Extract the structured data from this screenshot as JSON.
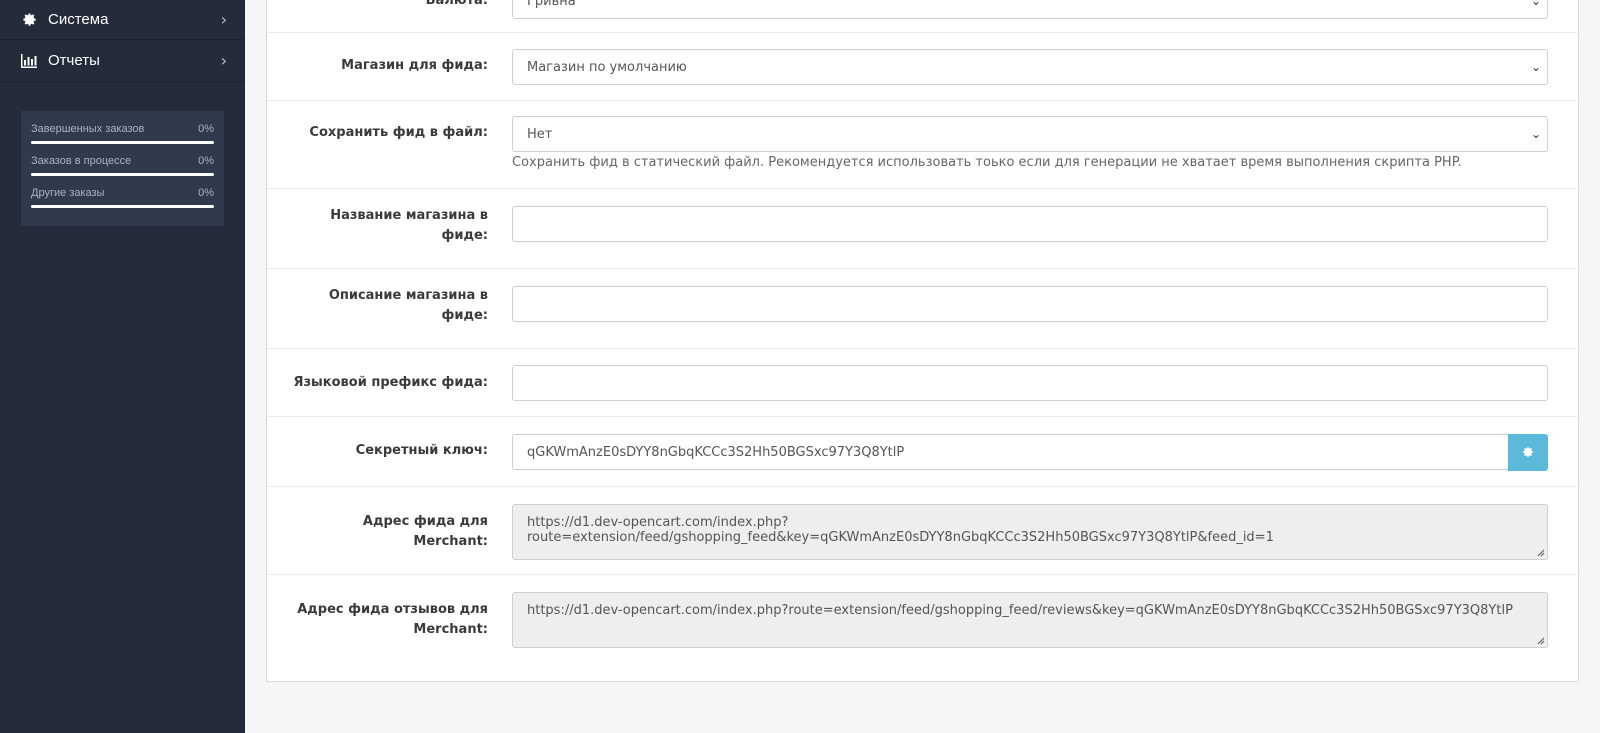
{
  "sidebar": {
    "items": [
      {
        "label": "Система",
        "icon": "gear-icon"
      },
      {
        "label": "Отчеты",
        "icon": "bar-chart-icon"
      }
    ],
    "stats": [
      {
        "label": "Завершенных заказов",
        "value": "0%",
        "fraction": 1.0
      },
      {
        "label": "Заказов в процессе",
        "value": "0%",
        "fraction": 1.0
      },
      {
        "label": "Другие заказы",
        "value": "0%",
        "fraction": 1.0
      }
    ]
  },
  "form": {
    "currency": {
      "label": "Валюта:",
      "value": "Гривна"
    },
    "store": {
      "label": "Магазин для фида:",
      "value": "Магазин по умолчанию"
    },
    "save_file": {
      "label": "Сохранить фид в файл:",
      "value": "Нет",
      "help": "Сохранить фид в статический файл. Рекомендуется использовать тоько если для генерации не хватает время выполнения скрипта PHP."
    },
    "store_name": {
      "label_line1": "Название магазина в",
      "label_line2": "фиде:",
      "value": ""
    },
    "store_desc": {
      "label_line1": "Описание магазина в",
      "label_line2": "фиде:",
      "value": ""
    },
    "lang_prefix": {
      "label": "Языковой префикс фида:",
      "value": ""
    },
    "secret_key": {
      "label": "Секретный ключ:",
      "value": "qGKWmAnzE0sDYY8nGbqKCCc3S2Hh50BGSxc97Y3Q8YtlP"
    },
    "feed_url": {
      "label_line1": "Адрес фида для",
      "label_line2": "Merchant:",
      "value": "https://d1.dev-opencart.com/index.php?route=extension/feed/gshopping_feed&key=qGKWmAnzE0sDYY8nGbqKCCc3S2Hh50BGSxc97Y3Q8YtlP&feed_id=1"
    },
    "reviews_url": {
      "label_line1": "Адрес фида отзывов для",
      "label_line2": "Merchant:",
      "value": "https://d1.dev-opencart.com/index.php?route=extension/feed/gshopping_feed/reviews&key=qGKWmAnzE0sDYY8nGbqKCCc3S2Hh50BGSxc97Y3Q8YtlP"
    }
  },
  "colors": {
    "sidebar": "#242c3b",
    "stats_bg": "#2f3a4d",
    "gear_button": "#5bb9d9"
  }
}
